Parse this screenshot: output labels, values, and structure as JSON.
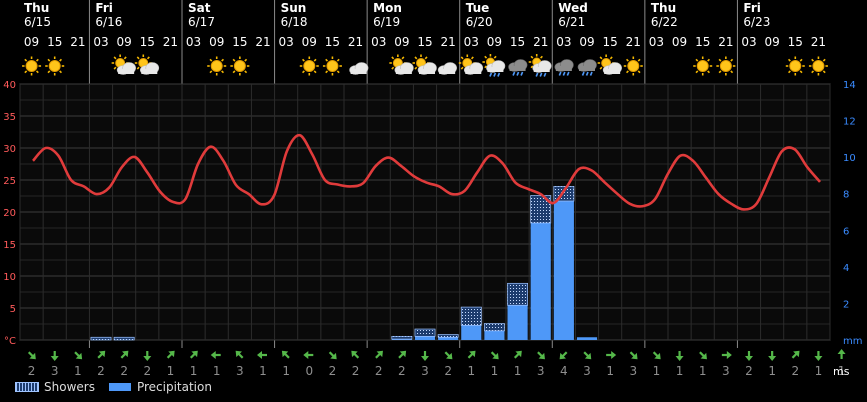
{
  "chart_data": {
    "type": "line",
    "days": [
      {
        "weekday": "Thu",
        "date": "6/15"
      },
      {
        "weekday": "Fri",
        "date": "6/16"
      },
      {
        "weekday": "Sat",
        "date": "6/17"
      },
      {
        "weekday": "Sun",
        "date": "6/18"
      },
      {
        "weekday": "Mon",
        "date": "6/19"
      },
      {
        "weekday": "Tue",
        "date": "6/20"
      },
      {
        "weekday": "Wed",
        "date": "6/21"
      },
      {
        "weekday": "Thu",
        "date": "6/22"
      },
      {
        "weekday": "Fri",
        "date": "6/23"
      }
    ],
    "hours": [
      "09",
      "15",
      "21",
      "03",
      "09",
      "15",
      "21",
      "03",
      "09",
      "15",
      "21",
      "03",
      "09",
      "15",
      "21",
      "03",
      "09",
      "15",
      "21",
      "03",
      "09",
      "15",
      "21",
      "03",
      "09",
      "15",
      "21",
      "03",
      "09",
      "15",
      "21",
      "03",
      "09",
      "15",
      "21"
    ],
    "weather_icons": [
      "sun",
      "sun",
      "moon",
      "moon",
      "partly-cloudy",
      "partly-cloudy",
      "moon",
      "moon",
      "sun",
      "sun",
      "moon",
      "moon",
      "sun",
      "sun",
      "partly-cloudy-night",
      "moon",
      "partly-cloudy",
      "partly-cloudy",
      "cloudy-night",
      "partly-cloudy",
      "showers",
      "heavy-showers",
      "showers",
      "heavy-showers",
      "heavy-showers",
      "partly-cloudy",
      "sun",
      "moon",
      "moon",
      "sun",
      "sun",
      "moon",
      "moon",
      "sun",
      "sun",
      "moon"
    ],
    "temperature_axis": {
      "unit": "°C",
      "min": 0,
      "max": 40,
      "ticks": [
        40,
        35,
        30,
        25,
        20,
        15,
        10,
        5
      ]
    },
    "precip_axis": {
      "unit": "mm",
      "min": 0,
      "max": 14,
      "ticks": [
        14,
        12,
        10,
        8,
        6,
        4,
        2
      ]
    },
    "temperature": [
      28.0,
      30.0,
      28.8,
      25.0,
      24.0,
      22.8,
      23.8,
      27.0,
      28.6,
      26.2,
      23.2,
      21.6,
      22.0,
      27.5,
      30.2,
      28.0,
      24.2,
      22.8,
      21.2,
      22.6,
      29.5,
      32.0,
      29.0,
      25.0,
      24.3,
      24.0,
      24.5,
      27.2,
      28.5,
      27.2,
      25.6,
      24.6,
      24.0,
      22.8,
      23.3,
      26.2,
      28.8,
      27.6,
      24.6,
      23.6,
      22.8,
      21.4,
      23.8,
      26.7,
      26.5,
      24.7,
      22.9,
      21.3,
      20.9,
      22.0,
      25.9,
      28.8,
      28.0,
      25.4,
      22.8,
      21.3,
      20.4,
      21.3,
      25.4,
      29.5,
      29.8,
      27.0,
      24.7
    ],
    "precip_bars": [
      {
        "index": 3,
        "rain": 0.0,
        "showers": 0.15
      },
      {
        "index": 4,
        "rain": 0.0,
        "showers": 0.15
      },
      {
        "index": 16,
        "rain": 0.05,
        "showers": 0.15
      },
      {
        "index": 17,
        "rain": 0.2,
        "showers": 0.4
      },
      {
        "index": 18,
        "rain": 0.15,
        "showers": 0.15
      },
      {
        "index": 19,
        "rain": 0.8,
        "showers": 1.0
      },
      {
        "index": 20,
        "rain": 0.5,
        "showers": 0.4
      },
      {
        "index": 21,
        "rain": 1.9,
        "showers": 1.2
      },
      {
        "index": 22,
        "rain": 6.4,
        "showers": 1.5
      },
      {
        "index": 23,
        "rain": 7.6,
        "showers": 0.8
      },
      {
        "index": 24,
        "rain": 0.15,
        "showers": 0.0
      }
    ],
    "wind": {
      "unit": "ms",
      "speeds": [
        2,
        3,
        1,
        2,
        2,
        2,
        1,
        1,
        1,
        3,
        1,
        1,
        0,
        2,
        2,
        2,
        2,
        3,
        2,
        1,
        1,
        1,
        3,
        4,
        3,
        1,
        3,
        1,
        1,
        1,
        3,
        2,
        1,
        2,
        1,
        1
      ],
      "directions": [
        "se",
        "s",
        "se",
        "ne",
        "ne",
        "s",
        "ne",
        "ne",
        "w",
        "nw",
        "w",
        "nw",
        "w",
        "se",
        "nw",
        "ne",
        "ne",
        "s",
        "se",
        "ne",
        "se",
        "ne",
        "se",
        "sw",
        "se",
        "e",
        "se",
        "se",
        "s",
        "se",
        "e",
        "s",
        "s",
        "ne",
        "s",
        "n"
      ]
    },
    "legend": [
      "Showers",
      "Precipitation"
    ],
    "colors": {
      "temperature": "#e03b3b",
      "precipitation": "#4e98f8",
      "showers": "#9fc4ff",
      "left_axis": "#ff5a5a",
      "right_axis": "#3a8bff",
      "wind_arrow": "#55b84a",
      "grid": "#3a3a3a",
      "day_line": "#8a8a8a"
    }
  }
}
